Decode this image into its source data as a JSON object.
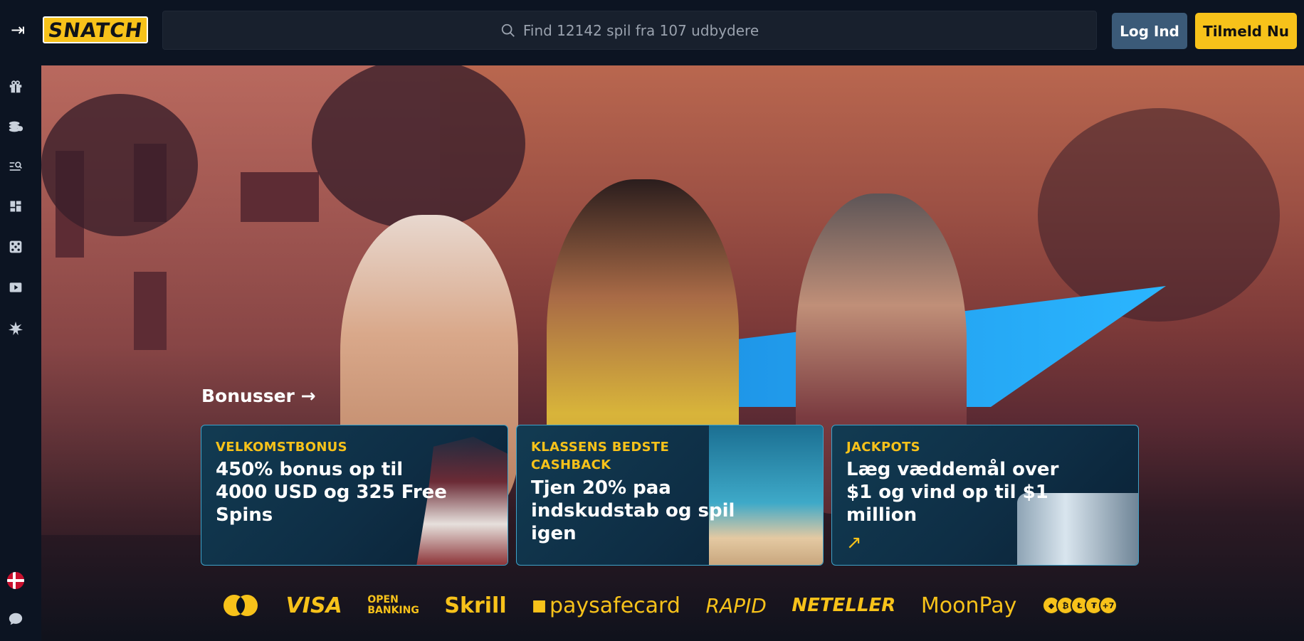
{
  "header": {
    "logo_text": "SNATCH",
    "search_placeholder": "Find 12142 spil fra 107 udbydere",
    "login_label": "Log Ind",
    "signup_label": "Tilmeld Nu"
  },
  "sidebar": {
    "icons": [
      "gift-icon",
      "coins-icon",
      "search-list-icon",
      "dashboard-icon",
      "dice-icon",
      "live-play-icon",
      "star-burst-icon"
    ],
    "language_flag": "denmark-flag-icon",
    "chat_icon": "chat-icon"
  },
  "hero": {
    "bonus_link": "Bonusser",
    "cards": [
      {
        "category": "VELKOMSTBONUS",
        "title": "450% bonus op til 4000 USD og 325 Free Spins"
      },
      {
        "category": "KLASSENS BEDSTE CASHBACK",
        "title": "Tjen 20% paa indskudstab og spil igen"
      },
      {
        "category": "JACKPOTS",
        "title": "Læg væddemål over $1 og vind op til $1 million"
      }
    ]
  },
  "payments": {
    "visa": "VISA",
    "open_banking_line1": "OPEN",
    "open_banking_line2": "BANKING",
    "skrill": "Skrill",
    "paysafe": "paysafecard",
    "rapid": "RAPID",
    "neteller": "NETELLER",
    "moonpay": "MoonPay",
    "crypto_more": "+7"
  },
  "colors": {
    "accent": "#f7c21a",
    "login": "#3b5a78",
    "background": "#0c1422"
  }
}
